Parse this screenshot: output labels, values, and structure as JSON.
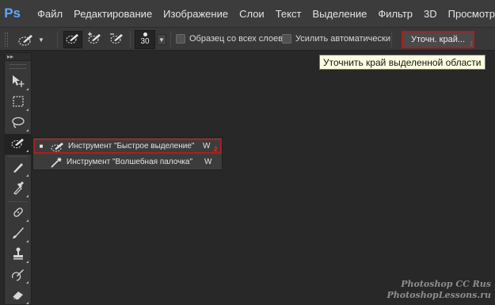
{
  "app": {
    "logo": "Ps"
  },
  "menu": [
    "Файл",
    "Редактирование",
    "Изображение",
    "Слои",
    "Текст",
    "Выделение",
    "Фильтр",
    "3D",
    "Просмотр"
  ],
  "options": {
    "brush_size": "30",
    "sample_all_layers": "Образец со всех слоев",
    "auto_enhance": "Усилить автоматически",
    "refine_edge": "Уточн. край...",
    "refine_mark": "1"
  },
  "tooltip": "Уточнить край выделенной области",
  "flyout": {
    "items": [
      {
        "label": "Инструмент \"Быстрое выделение\"",
        "shortcut": "W",
        "bullet": "■"
      },
      {
        "label": "Инструмент \"Волшебная палочка\"",
        "shortcut": "W",
        "bullet": ""
      }
    ],
    "mark": "2"
  },
  "toolbar": {
    "collapse": "▸▸"
  },
  "watermark": [
    "Photoshop  CC  Rus",
    "PhotoshopLessons.ru"
  ],
  "colors": {
    "accent_red": "#b21c1c",
    "tooltip_bg": "#fffee1",
    "ps_blue": "#5aa9ff"
  }
}
